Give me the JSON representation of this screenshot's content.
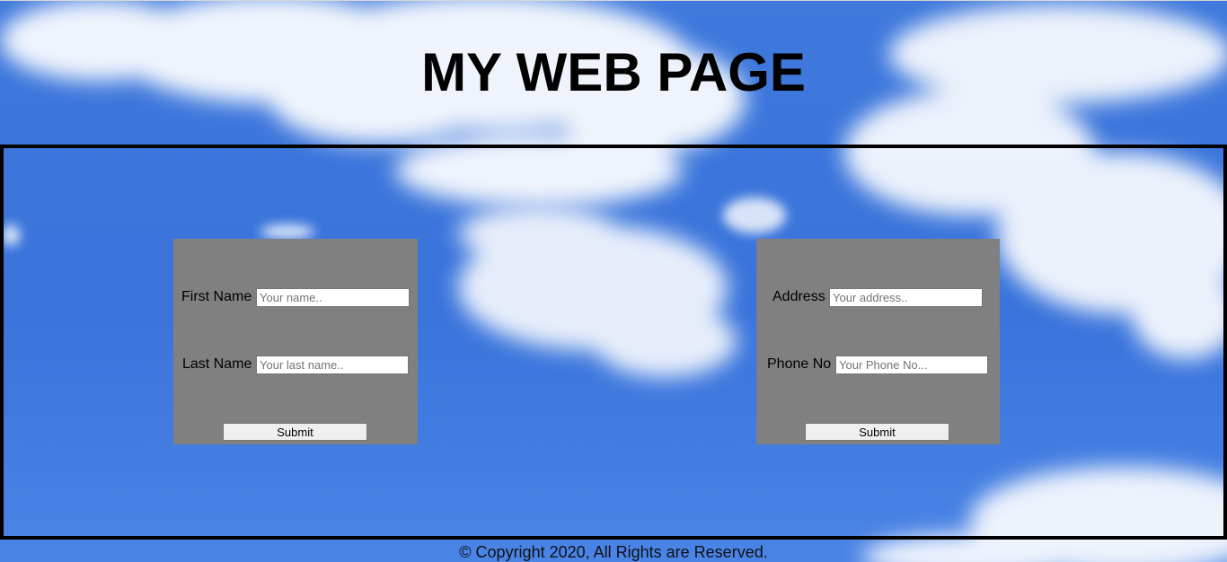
{
  "header": {
    "title": "MY WEB PAGE"
  },
  "form_left": {
    "first_name_label": "First Name",
    "first_name_placeholder": "Your name..",
    "last_name_label": "Last Name",
    "last_name_placeholder": "Your last name..",
    "submit_label": "Submit"
  },
  "form_right": {
    "address_label": "Address",
    "address_placeholder": "Your address..",
    "phone_label": "Phone No",
    "phone_placeholder": "Your Phone No...",
    "submit_label": "Submit"
  },
  "footer": {
    "copyright": "© Copyright 2020, All Rights are Reserved."
  },
  "colors": {
    "sky": "#3f79dc",
    "form_background": "#808080",
    "border": "#000000"
  }
}
